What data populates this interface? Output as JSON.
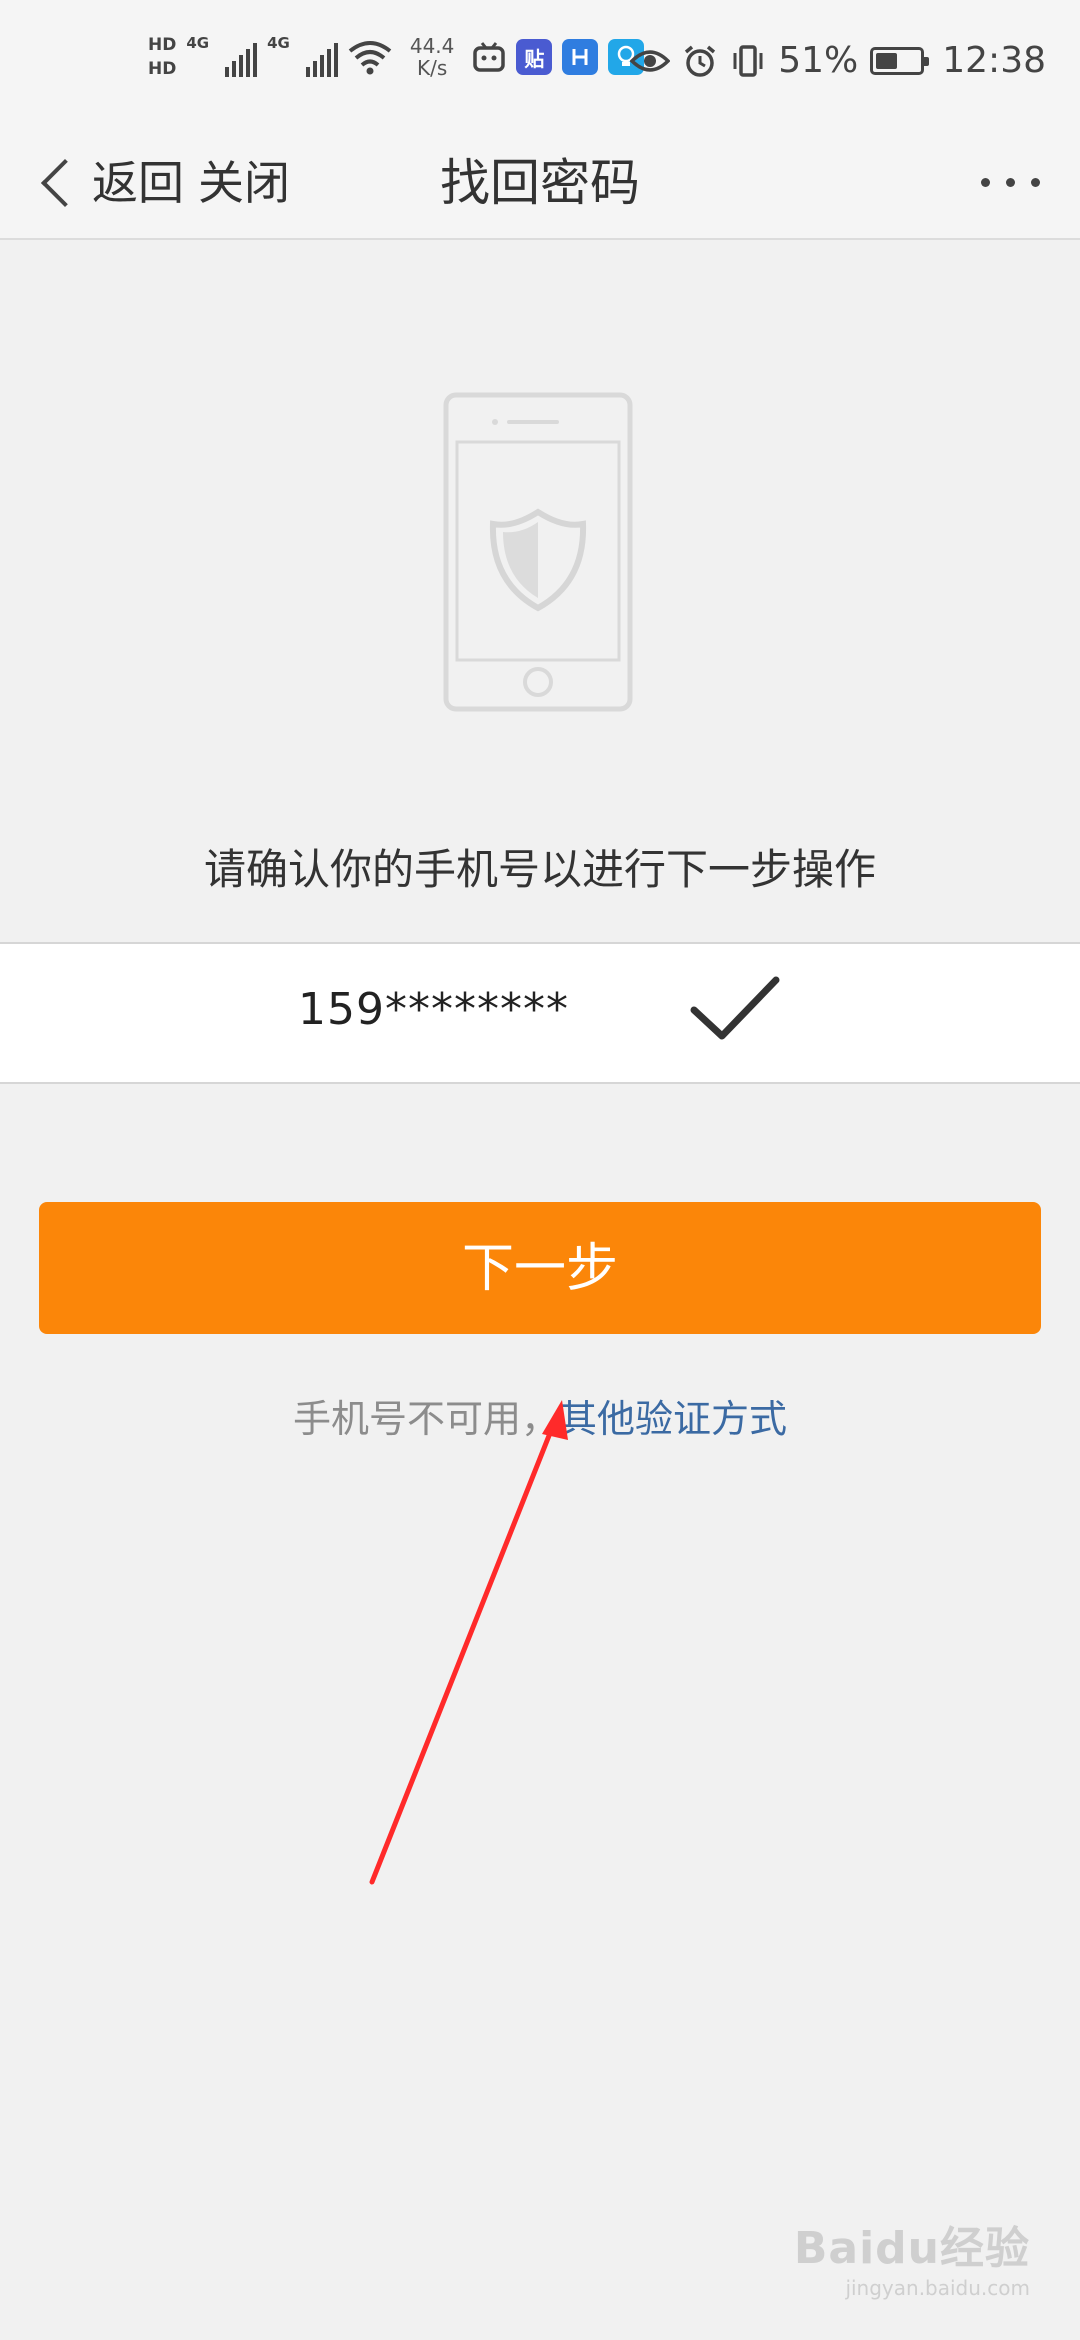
{
  "status_bar": {
    "hd1": "HD",
    "hd2": "HD",
    "sim1_net": "4G",
    "sim2_net": "4G",
    "net_speed_value": "44.4",
    "net_speed_unit": "K/s",
    "app_icon_tieba": "贴",
    "battery_percent_text": "51%",
    "battery_level": 0.51,
    "time": "12:38"
  },
  "nav": {
    "back_label": "返回",
    "close_label": "关闭",
    "title": "找回密码"
  },
  "main": {
    "hint": "请确认你的手机号以进行下一步操作",
    "phone_masked": "159********",
    "next_button": "下一步",
    "alt_prefix": "手机号不可用，",
    "alt_link": "其他验证方式"
  },
  "watermark": {
    "brand": "Baidu经验",
    "site": "jingyan.baidu.com"
  },
  "colors": {
    "accent_orange": "#fb8609",
    "link_blue": "#3b6aa3",
    "annotation_red": "#ff2a2a",
    "background": "#f1f1f1"
  }
}
